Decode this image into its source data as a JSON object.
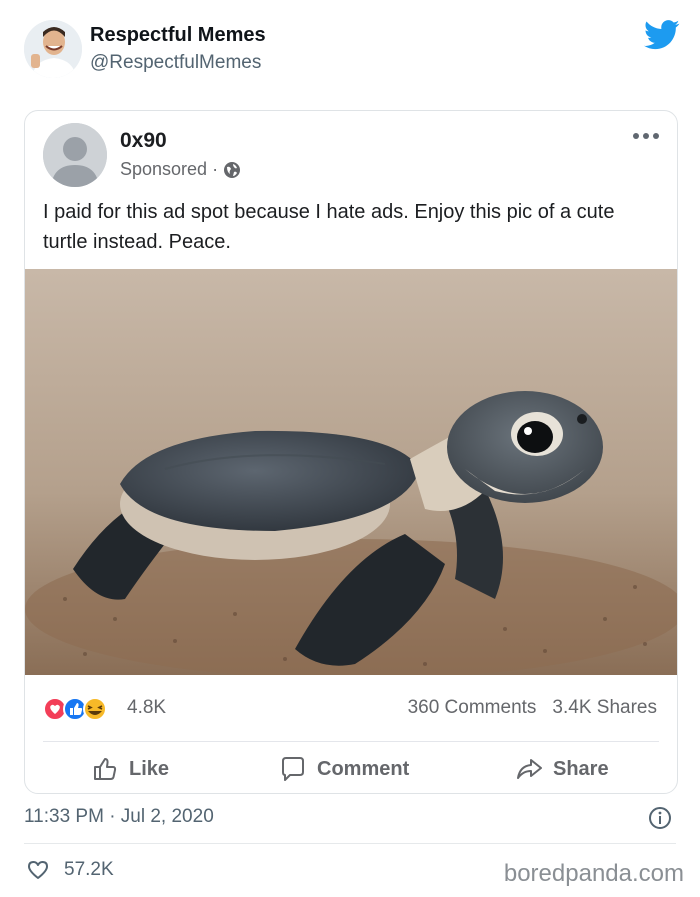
{
  "tweet": {
    "author_name": "Respectful Memes",
    "author_handle": "@RespectfulMemes",
    "timestamp": "11:33 PM · Jul 2, 2020",
    "likes": "57.2K"
  },
  "fb_post": {
    "page_name": "0x90",
    "sponsored": "Sponsored",
    "separator": "·",
    "text": "I paid for this ad spot because I hate ads. Enjoy this pic of a cute turtle instead. Peace.",
    "reactions_count": "4.8K",
    "comments_count": "360 Comments",
    "shares_count": "3.4K Shares",
    "actions": {
      "like": "Like",
      "comment": "Comment",
      "share": "Share"
    }
  },
  "watermark": "boredpanda.com",
  "icons": {
    "brand": "twitter-bird-icon",
    "reactions": [
      "love-reaction-icon",
      "like-reaction-icon",
      "haha-reaction-icon"
    ]
  },
  "colors": {
    "twitter_blue": "#1d9bf0",
    "fb_like_blue": "#1877f2",
    "fb_love_red": "#f33e58",
    "haha_yellow": "#f7b928"
  }
}
